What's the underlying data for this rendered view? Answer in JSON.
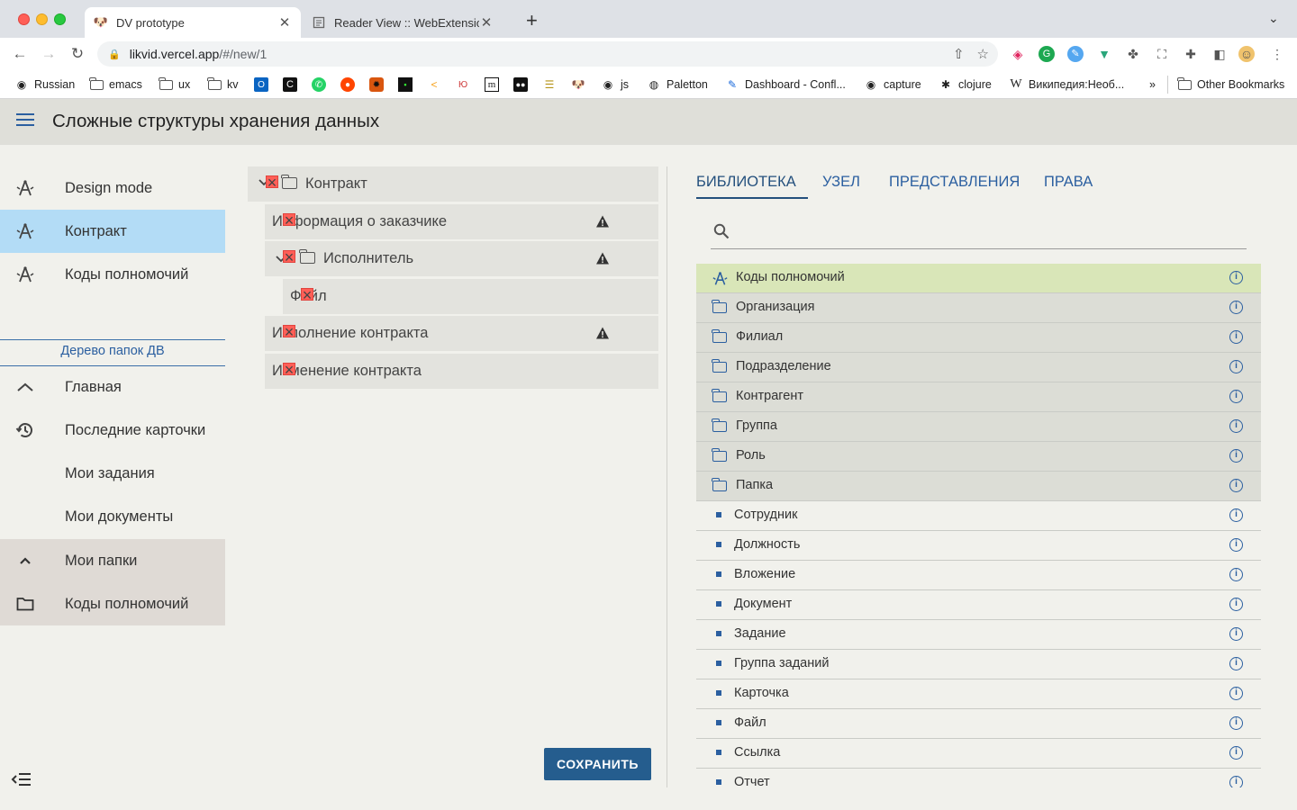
{
  "browser": {
    "tabs": [
      {
        "title": "DV prototype",
        "icon": "dog-favicon"
      },
      {
        "title": "Reader View :: WebExtension.C",
        "icon": "page-favicon"
      }
    ],
    "url_host": "likvid.vercel.app",
    "url_path": "/#/new/1",
    "bookmarks": [
      {
        "label": "Russian",
        "icon": "globe-icon"
      },
      {
        "label": "emacs",
        "icon": "folder-icon"
      },
      {
        "label": "ux",
        "icon": "folder-icon"
      },
      {
        "label": "kv",
        "icon": "folder-icon"
      },
      {
        "label": "js",
        "icon": "globe-icon"
      },
      {
        "label": "Paletton",
        "icon": "paletton-icon"
      },
      {
        "label": "Dashboard - Confl...",
        "icon": "confluence-icon"
      },
      {
        "label": "capture",
        "icon": "globe-icon"
      },
      {
        "label": "clojure",
        "icon": "clojure-icon"
      },
      {
        "label": "Википедия:Необ...",
        "icon": "wikipedia-icon"
      },
      {
        "label": "»",
        "icon": ""
      },
      {
        "label": "Other Bookmarks",
        "icon": "folder-icon"
      }
    ]
  },
  "app": {
    "title": "Сложные структуры хранения данных"
  },
  "sidebar": {
    "items": [
      {
        "label": "Design mode",
        "icon": "design-icon"
      },
      {
        "label": "Контракт",
        "icon": "design-icon"
      },
      {
        "label": "Коды полномочий",
        "icon": "design-icon"
      }
    ],
    "caption": "Дерево папок ДВ",
    "nav": [
      {
        "label": "Главная",
        "icon": "chevron-up-icon"
      },
      {
        "label": "Последние карточки",
        "icon": "history-icon"
      },
      {
        "label": "Мои задания",
        "icon": ""
      },
      {
        "label": "Мои документы",
        "icon": ""
      },
      {
        "label": "Мои папки",
        "icon": "chevron-up-icon"
      },
      {
        "label": "Коды полномочий",
        "icon": "folder-icon"
      }
    ]
  },
  "tree": {
    "rows": [
      {
        "label": "Контракт",
        "warning": false
      },
      {
        "label": "Информация о заказчике",
        "warning": true
      },
      {
        "label": "Исполнитель",
        "warning": true
      },
      {
        "label": "Файл",
        "warning": false
      },
      {
        "label": "Исполнение контракта",
        "warning": true
      },
      {
        "label": "Изменение контракта",
        "warning": false
      }
    ],
    "save_label": "СОХРАНИТЬ"
  },
  "panel": {
    "tabs": [
      "БИБЛИОТЕКА",
      "УЗЕЛ",
      "ПРЕДСТАВЛЕНИЯ",
      "ПРАВА"
    ],
    "active_tab": "БИБЛИОТЕКА",
    "search_placeholder": "",
    "library": [
      {
        "label": "Коды полномочий",
        "kind": "special"
      },
      {
        "label": "Организация",
        "kind": "folder"
      },
      {
        "label": "Филиал",
        "kind": "folder"
      },
      {
        "label": "Подразделение",
        "kind": "folder"
      },
      {
        "label": "Контрагент",
        "kind": "folder"
      },
      {
        "label": "Группа",
        "kind": "folder"
      },
      {
        "label": "Роль",
        "kind": "folder"
      },
      {
        "label": "Папка",
        "kind": "folder"
      },
      {
        "label": "Сотрудник",
        "kind": "leaf"
      },
      {
        "label": "Должность",
        "kind": "leaf"
      },
      {
        "label": "Вложение",
        "kind": "leaf"
      },
      {
        "label": "Документ",
        "kind": "leaf"
      },
      {
        "label": "Задание",
        "kind": "leaf"
      },
      {
        "label": "Группа заданий",
        "kind": "leaf"
      },
      {
        "label": "Карточка",
        "kind": "leaf"
      },
      {
        "label": "Файл",
        "kind": "leaf"
      },
      {
        "label": "Ссылка",
        "kind": "leaf"
      },
      {
        "label": "Отчет",
        "kind": "leaf"
      }
    ]
  },
  "colors": {
    "accent": "#2b5fa0",
    "selected_bg": "#b3dcf6",
    "special_bg": "#d9e6b8",
    "folder_bg": "#dcddd6",
    "save_bg": "#255d8e"
  }
}
